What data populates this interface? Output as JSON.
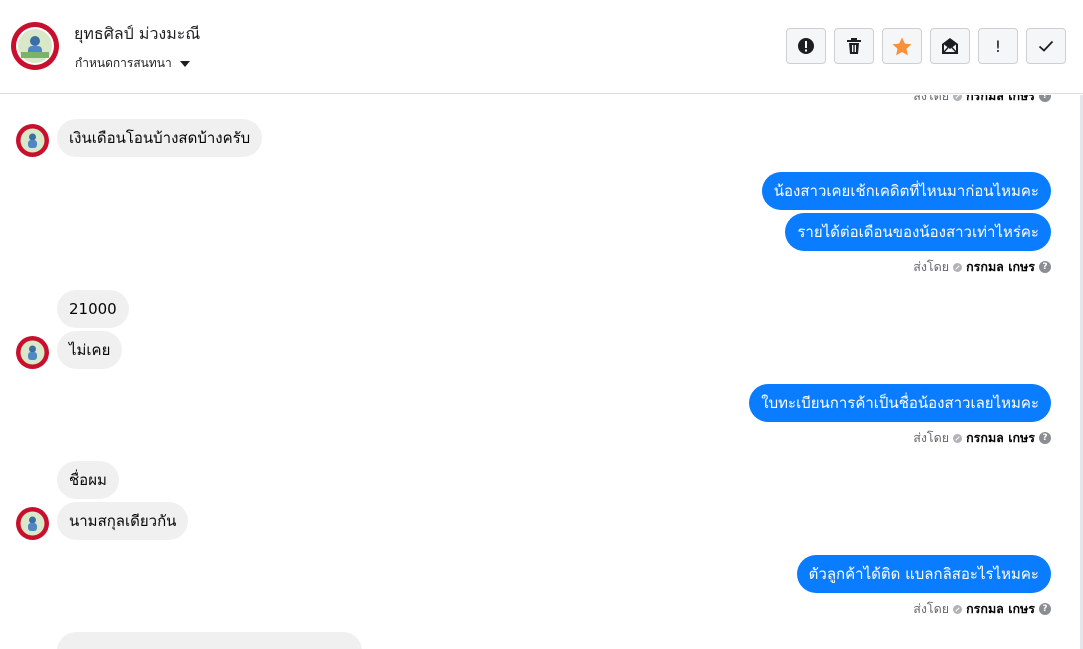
{
  "header": {
    "name": "ยุทธศิลป์ ม่วงมะณี",
    "subtitle": "กำหนดการสนทนา",
    "avatar_icon": "profile-avatar",
    "actions": [
      {
        "name": "report-icon",
        "label": "!"
      },
      {
        "name": "trash-icon"
      },
      {
        "name": "star-icon",
        "color": "#f7923b"
      },
      {
        "name": "mark-unread-icon"
      },
      {
        "name": "priority-icon",
        "label": "!"
      },
      {
        "name": "check-icon"
      }
    ]
  },
  "messages": {
    "in_1": "เงินเดือนโอนบ้างสดบ้างครับ",
    "out_1": "น้องสาวเคยเช้กเคดิตที่ไหนมาก่อนไหมคะ",
    "out_2": "รายได้ต่อเดือนของน้องสาวเท่าไหร่คะ",
    "in_2": "21000",
    "in_3": "ไม่เคย",
    "out_3": "ใบทะเบียนการค้าเป็นชื่อน้องสาวเลยไหมคะ",
    "in_4": "ชื่อผม",
    "in_5": "นามสกุลเดียวกัน",
    "out_4": "ตัวลูกค้าได้ติด แบลกลิสอะไรไหมคะ"
  },
  "sent_by": {
    "prefix": "ส่งโดย",
    "agent": "กรกมล เกษร"
  },
  "colors": {
    "outgoing": "#0a7cff",
    "incoming": "#f0f0f0"
  }
}
